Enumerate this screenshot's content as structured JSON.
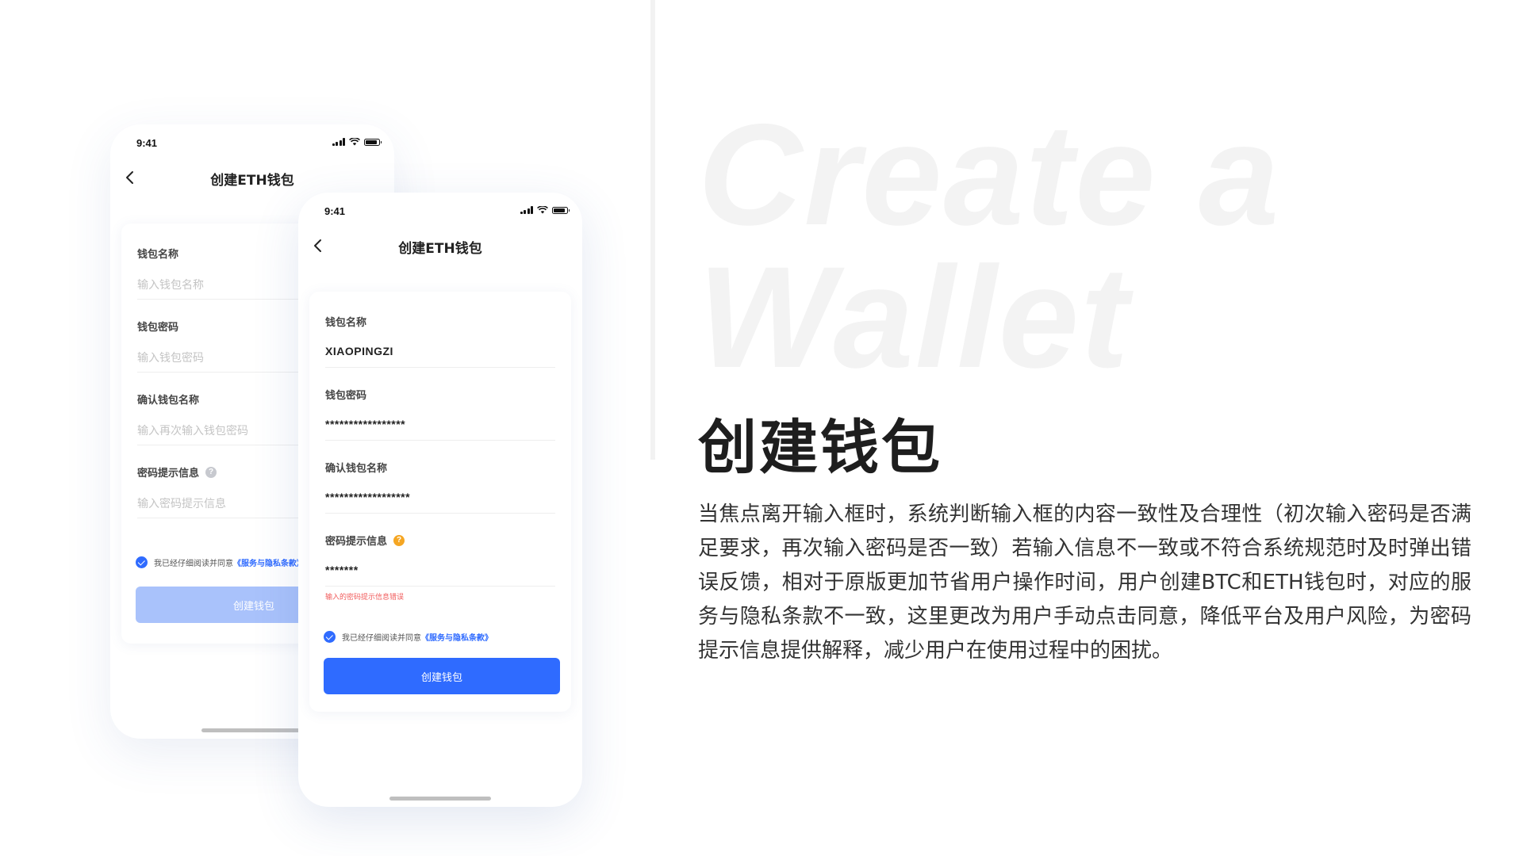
{
  "showcase": {
    "watermark": "Create a\nWallet",
    "headline": "创建钱包",
    "description": "当焦点离开输入框时，系统判断输入框的内容一致性及合理性（初次输入密码是否满足要求，再次输入密码是否一致）若输入信息不一致或不符合系统规范时及时弹出错误反馈，相对于原版更加节省用户操作时间，用户创建BTC和ETH钱包时，对应的服务与隐私条款不一致，这里更改为用户手动点击同意，降低平台及用户风险，为密码提示信息提供解释，减少用户在使用过程中的困扰。"
  },
  "back_phone": {
    "time": "9:41",
    "title": "创建ETH钱包",
    "fields": [
      {
        "label": "钱包名称",
        "placeholder": "输入钱包名称"
      },
      {
        "label": "钱包密码",
        "placeholder": "输入钱包密码"
      },
      {
        "label": "确认钱包名称",
        "placeholder": "输入再次输入钱包密码"
      },
      {
        "label": "密码提示信息",
        "placeholder": "输入密码提示信息"
      }
    ],
    "agree_text": "我已经仔细阅读并同意",
    "agree_link": "《服务与隐私条款》",
    "button_label": "创建钱包"
  },
  "front_phone": {
    "time": "9:41",
    "title": "创建ETH钱包",
    "fields": [
      {
        "label": "钱包名称",
        "value": "XIAOPINGZI"
      },
      {
        "label": "钱包密码",
        "value": "*****************"
      },
      {
        "label": "确认钱包名称",
        "value": "******************"
      },
      {
        "label": "密码提示信息",
        "value": "*******",
        "error": "输入的密码提示信息错误"
      }
    ],
    "agree_text": "我已经仔细阅读并同意",
    "agree_link": "《服务与隐私条款》",
    "button_label": "创建钱包"
  },
  "icons": {
    "back": "chevron-left-icon",
    "help": "question-circle-icon",
    "check": "check-circle-icon",
    "signal": "signal-icon",
    "wifi": "wifi-icon",
    "battery": "battery-icon"
  },
  "colors": {
    "primary": "#2f6bff",
    "primary_disabled": "#a9c2fb",
    "error": "#f15b5b",
    "help_warning": "#f5a623",
    "watermark": "#f3f3f3"
  }
}
